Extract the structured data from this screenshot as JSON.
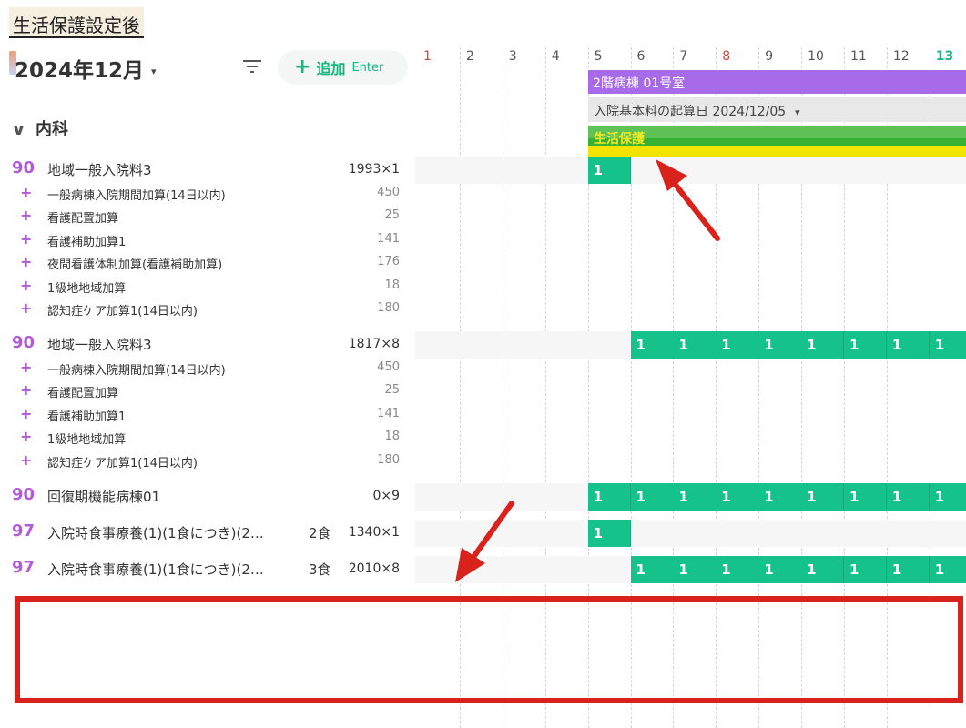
{
  "caption": "生活保護設定後",
  "toolbar": {
    "month": "2024年12月",
    "month_caret": "▾",
    "add_plus": "+",
    "add_label": "追加",
    "add_key": "Enter"
  },
  "department": {
    "chevron": "∨",
    "name": "内科"
  },
  "calendar": {
    "days": [
      "1",
      "2",
      "3",
      "4",
      "5",
      "6",
      "7",
      "8",
      "9",
      "10",
      "11",
      "12",
      "13"
    ],
    "red_days": [
      "1",
      "8"
    ],
    "today": "13"
  },
  "bars": {
    "ward": "2階病棟 01号室",
    "start_date": "入院基本料の起算日 2024/12/05",
    "start_date_caret": "▾",
    "welfare": "生活保護"
  },
  "groups": [
    {
      "code": "90",
      "name": "地域一般入院料3",
      "qty": "1993×1",
      "cells": [
        "1"
      ],
      "additions": [
        {
          "plus": "+",
          "name": "一般病棟入院期間加算(14日以内)",
          "points": "450"
        },
        {
          "plus": "+",
          "name": "看護配置加算",
          "points": "25"
        },
        {
          "plus": "+",
          "name": "看護補助加算1",
          "points": "141"
        },
        {
          "plus": "+",
          "name": "夜間看護体制加算(看護補助加算)",
          "points": "176"
        },
        {
          "plus": "+",
          "name": "1級地地域加算",
          "points": "18"
        },
        {
          "plus": "+",
          "name": "認知症ケア加算1(14日以内)",
          "points": "180"
        }
      ]
    },
    {
      "code": "90",
      "name": "地域一般入院料3",
      "qty": "1817×8",
      "cells": [
        "1",
        "1",
        "1",
        "1",
        "1",
        "1",
        "1",
        "1"
      ],
      "additions": [
        {
          "plus": "+",
          "name": "一般病棟入院期間加算(14日以内)",
          "points": "450"
        },
        {
          "plus": "+",
          "name": "看護配置加算",
          "points": "25"
        },
        {
          "plus": "+",
          "name": "看護補助加算1",
          "points": "141"
        },
        {
          "plus": "+",
          "name": "1級地地域加算",
          "points": "18"
        },
        {
          "plus": "+",
          "name": "認知症ケア加算1(14日以内)",
          "points": "180"
        }
      ]
    },
    {
      "code": "90",
      "name": "回復期機能病棟01",
      "qty": "0×9",
      "meals": "",
      "cells": [
        "1",
        "1",
        "1",
        "1",
        "1",
        "1",
        "1",
        "1",
        "1"
      ]
    },
    {
      "code": "97",
      "name": "入院時食事療養(1)(1食につき)(2…",
      "meals": "2食",
      "qty": "1340×1",
      "cells": [
        "1"
      ]
    },
    {
      "code": "97",
      "name": "入院時食事療養(1)(1食につき)(2…",
      "meals": "3食",
      "qty": "2010×8",
      "cells": [
        "1",
        "1",
        "1",
        "1",
        "1",
        "1",
        "1",
        "1"
      ]
    }
  ],
  "colors": {
    "accent_green": "#14c28a",
    "ward_purple": "#a76bea",
    "welfare_green": "#5fc257",
    "welfare_yellow": "#f2e300",
    "code_purple": "#b35ad8",
    "annotation_red": "#d9221c"
  }
}
